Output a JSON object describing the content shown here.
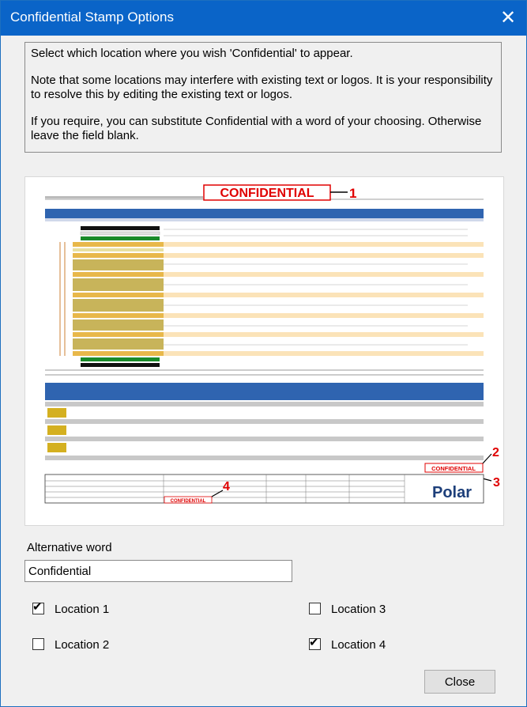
{
  "window": {
    "title": "Confidential Stamp Options",
    "close_glyph": "✕"
  },
  "info": {
    "line1": "Select which location where you wish 'Confidential' to appear.",
    "line2": "Note that some locations may interfere with existing text or logos.  It is your responsibility to resolve this by editing the existing text or logos.",
    "line3": "If you require, you can substitute Confidential with a word of your choosing. Otherwise leave the field blank."
  },
  "preview": {
    "stamp_text": "CONFIDENTIAL",
    "markers": [
      "1",
      "2",
      "3",
      "4"
    ],
    "logo": "Polar"
  },
  "alt_word": {
    "label": "Alternative word",
    "value": "Confidential"
  },
  "locations": [
    {
      "label": "Location 1",
      "checked": true
    },
    {
      "label": "Location 2",
      "checked": false
    },
    {
      "label": "Location 3",
      "checked": false
    },
    {
      "label": "Location 4",
      "checked": true
    }
  ],
  "buttons": {
    "close": "Close"
  },
  "colors": {
    "titlebar": "#0a64c8",
    "stamp_red": "#e00000",
    "copper": "#e8b84a",
    "dielectric": "#c8b45a"
  }
}
